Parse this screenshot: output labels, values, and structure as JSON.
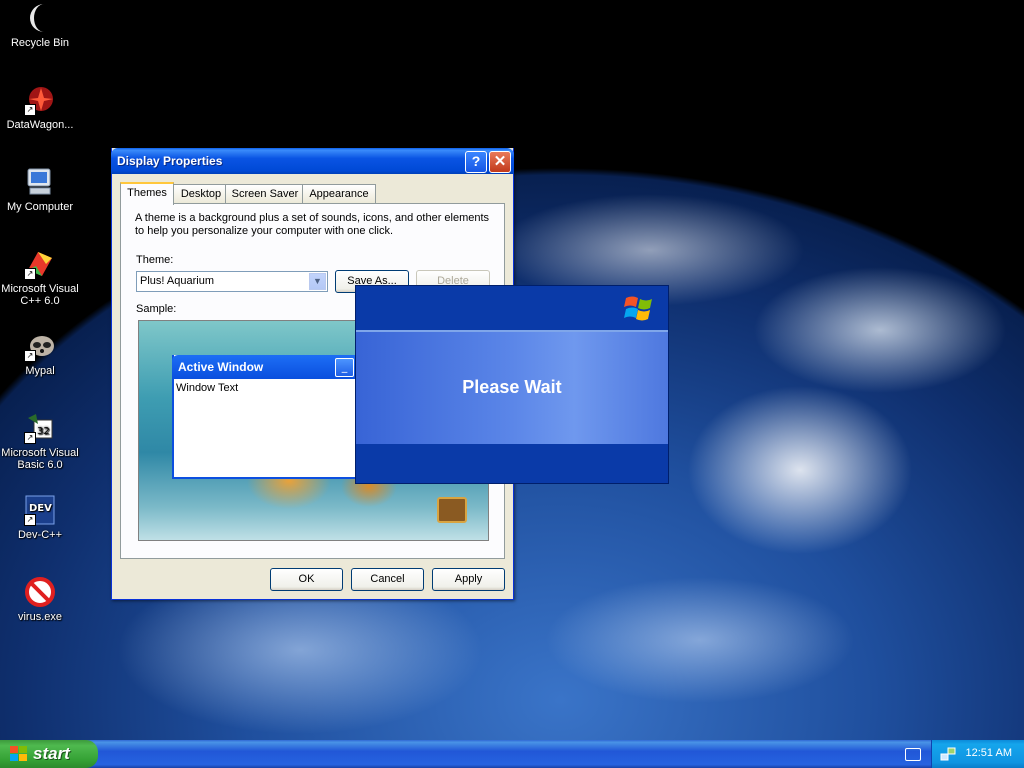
{
  "desktop": {
    "icons": [
      {
        "label": "Recycle Bin",
        "icon": "moon-recycle-bin-icon"
      },
      {
        "label": "DataWagon...",
        "icon": "datawagon-icon"
      },
      {
        "label": "My Computer",
        "icon": "computer-icon"
      },
      {
        "label": "Microsoft Visual C++ 6.0",
        "icon": "visual-cpp-icon"
      },
      {
        "label": "Mypal",
        "icon": "raccoon-icon"
      },
      {
        "label": "Microsoft Visual Basic 6.0",
        "icon": "visual-basic-icon"
      },
      {
        "label": "Dev-C++",
        "icon": "dev-cpp-icon"
      },
      {
        "label": "virus.exe",
        "icon": "no-entry-icon"
      }
    ]
  },
  "display_properties": {
    "title": "Display Properties",
    "help_button": "?",
    "close_button": "✕",
    "tabs": [
      "Themes",
      "Desktop",
      "Screen Saver",
      "Appearance"
    ],
    "active_tab": "Themes",
    "description": "A theme is a background plus a set of sounds, icons, and other elements to help you personalize your computer with one click.",
    "theme_label": "Theme:",
    "theme_value": "Plus! Aquarium",
    "save_as_label": "Save As...",
    "delete_label": "Delete",
    "sample_label": "Sample:",
    "sample_window_title": "Active Window",
    "sample_window_text": "Window Text",
    "ok_label": "OK",
    "cancel_label": "Cancel",
    "apply_label": "Apply"
  },
  "please_wait": {
    "message": "Please Wait"
  },
  "taskbar": {
    "start_label": "start",
    "clock": "12:51 AM"
  },
  "colors": {
    "title_blue": "#0a54e3",
    "wait_blue": "#0a3aa8",
    "start_green": "#35a235",
    "tray_blue": "#0f94e2"
  }
}
